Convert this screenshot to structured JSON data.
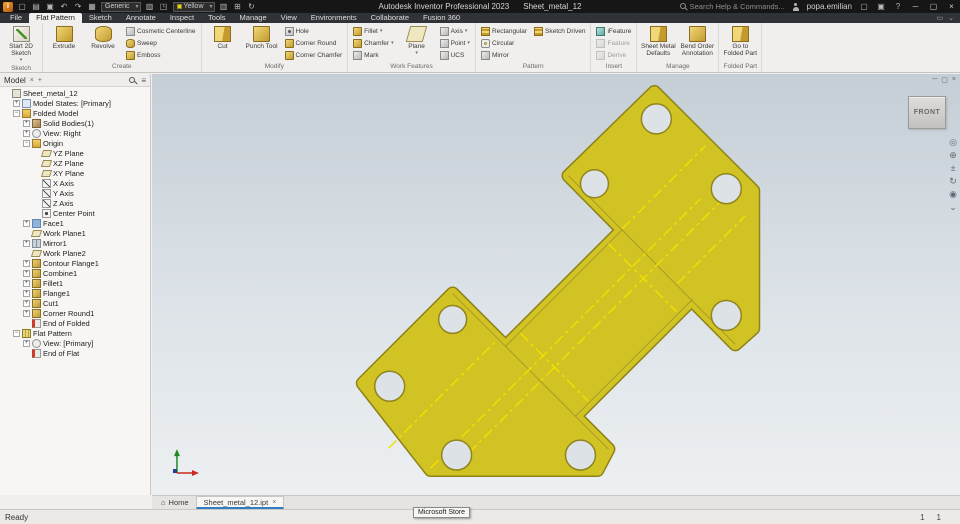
{
  "titlebar": {
    "app_title": "Autodesk Inventor Professional 2023",
    "doc_title": "Sheet_metal_12",
    "search_placeholder": "Search Help & Commands...",
    "user": "popa.emilian",
    "material": "Generic",
    "appearance": "Yellow"
  },
  "ribbon": {
    "tabs": [
      {
        "label": "File"
      },
      {
        "label": "Flat Pattern",
        "active": true
      },
      {
        "label": "Sketch"
      },
      {
        "label": "Annotate"
      },
      {
        "label": "Inspect"
      },
      {
        "label": "Tools"
      },
      {
        "label": "Manage"
      },
      {
        "label": "View"
      },
      {
        "label": "Environments"
      },
      {
        "label": "Collaborate"
      },
      {
        "label": "Fusion 360"
      }
    ],
    "panels": [
      {
        "label": "Sketch",
        "buttons": {
          "start2d": "Start 2D Sketch"
        }
      },
      {
        "label": "Create",
        "buttons": {
          "extrude": "Extrude",
          "revolve": "Revolve",
          "cosmetic": "Cosmetic Centerline",
          "sweep": "Sweep",
          "emboss": "Emboss"
        }
      },
      {
        "label": "Modify",
        "buttons": {
          "cut": "Cut",
          "punch": "Punch Tool",
          "hole": "Hole",
          "corner_round": "Corner Round",
          "corner_chamfer": "Corner Chamfer"
        }
      },
      {
        "label": "Work Features",
        "buttons": {
          "fillet": "Fillet",
          "chamfer": "Chamfer",
          "mark": "Mark",
          "plane": "Plane",
          "axis": "Axis",
          "point": "Point",
          "ucs": "UCS"
        }
      },
      {
        "label": "Pattern",
        "buttons": {
          "rectangular": "Rectangular",
          "circular": "Circular",
          "mirror": "Mirror",
          "sketch_driven": "Sketch Driven"
        }
      },
      {
        "label": "Insert",
        "buttons": {
          "ifeature": "iFeature",
          "feature": "Feature",
          "derive": "Derive"
        }
      },
      {
        "label": "Manage",
        "buttons": {
          "defaults": "Sheet Metal Defaults",
          "bend_order": "Bend Order Annotation"
        }
      },
      {
        "label": "Folded Part",
        "buttons": {
          "go_folded": "Go to Folded Part"
        }
      }
    ]
  },
  "browser": {
    "panel_title": "Model",
    "items": [
      {
        "label": "Sheet_metal_12",
        "level": 0,
        "exp": "",
        "icon": "part"
      },
      {
        "label": "Model States: [Primary]",
        "level": 1,
        "exp": "+",
        "icon": "model-states"
      },
      {
        "label": "Folded Model",
        "level": 1,
        "exp": "−",
        "icon": "folder"
      },
      {
        "label": "Solid Bodies(1)",
        "level": 2,
        "exp": "+",
        "icon": "solid"
      },
      {
        "label": "View: Right",
        "level": 2,
        "exp": "+",
        "icon": "view"
      },
      {
        "label": "Origin",
        "level": 2,
        "exp": "−",
        "icon": "origin"
      },
      {
        "label": "YZ Plane",
        "level": 3,
        "exp": "",
        "icon": "plane"
      },
      {
        "label": "XZ Plane",
        "level": 3,
        "exp": "",
        "icon": "plane"
      },
      {
        "label": "XY Plane",
        "level": 3,
        "exp": "",
        "icon": "plane"
      },
      {
        "label": "X Axis",
        "level": 3,
        "exp": "",
        "icon": "axis"
      },
      {
        "label": "Y Axis",
        "level": 3,
        "exp": "",
        "icon": "axis"
      },
      {
        "label": "Z Axis",
        "level": 3,
        "exp": "",
        "icon": "axis"
      },
      {
        "label": "Center Point",
        "level": 3,
        "exp": "",
        "icon": "point"
      },
      {
        "label": "Face1",
        "level": 2,
        "exp": "+",
        "icon": "face"
      },
      {
        "label": "Work Plane1",
        "level": 2,
        "exp": "",
        "icon": "workplane"
      },
      {
        "label": "Mirror1",
        "level": 2,
        "exp": "+",
        "icon": "mirror"
      },
      {
        "label": "Work Plane2",
        "level": 2,
        "exp": "",
        "icon": "workplane"
      },
      {
        "label": "Contour Flange1",
        "level": 2,
        "exp": "+",
        "icon": "flange"
      },
      {
        "label": "Combine1",
        "level": 2,
        "exp": "+",
        "icon": "combine"
      },
      {
        "label": "Fillet1",
        "level": 2,
        "exp": "+",
        "icon": "fillet"
      },
      {
        "label": "Flange1",
        "level": 2,
        "exp": "+",
        "icon": "flange"
      },
      {
        "label": "Cut1",
        "level": 2,
        "exp": "+",
        "icon": "cut"
      },
      {
        "label": "Corner Round1",
        "level": 2,
        "exp": "+",
        "icon": "corner"
      },
      {
        "label": "End of Folded",
        "level": 2,
        "exp": "",
        "icon": "eof"
      },
      {
        "label": "Flat Pattern",
        "level": 1,
        "exp": "−",
        "icon": "flat"
      },
      {
        "label": "View: [Primary]",
        "level": 2,
        "exp": "+",
        "icon": "view"
      },
      {
        "label": "End of Flat",
        "level": 2,
        "exp": "",
        "icon": "eof"
      }
    ]
  },
  "viewport": {
    "viewcube_face": "FRONT"
  },
  "doc_tabs": {
    "home": "Home",
    "active_doc": "Sheet_metal_12.ipt"
  },
  "tooltip": "Microsoft Store",
  "status": {
    "left": "Ready",
    "right_values": [
      "1",
      "1"
    ]
  },
  "colors": {
    "part_fill": "#d2c324",
    "part_edge": "#8c8218",
    "bend_line": "#f0df00",
    "accent_blue": "#2f7fc1"
  }
}
